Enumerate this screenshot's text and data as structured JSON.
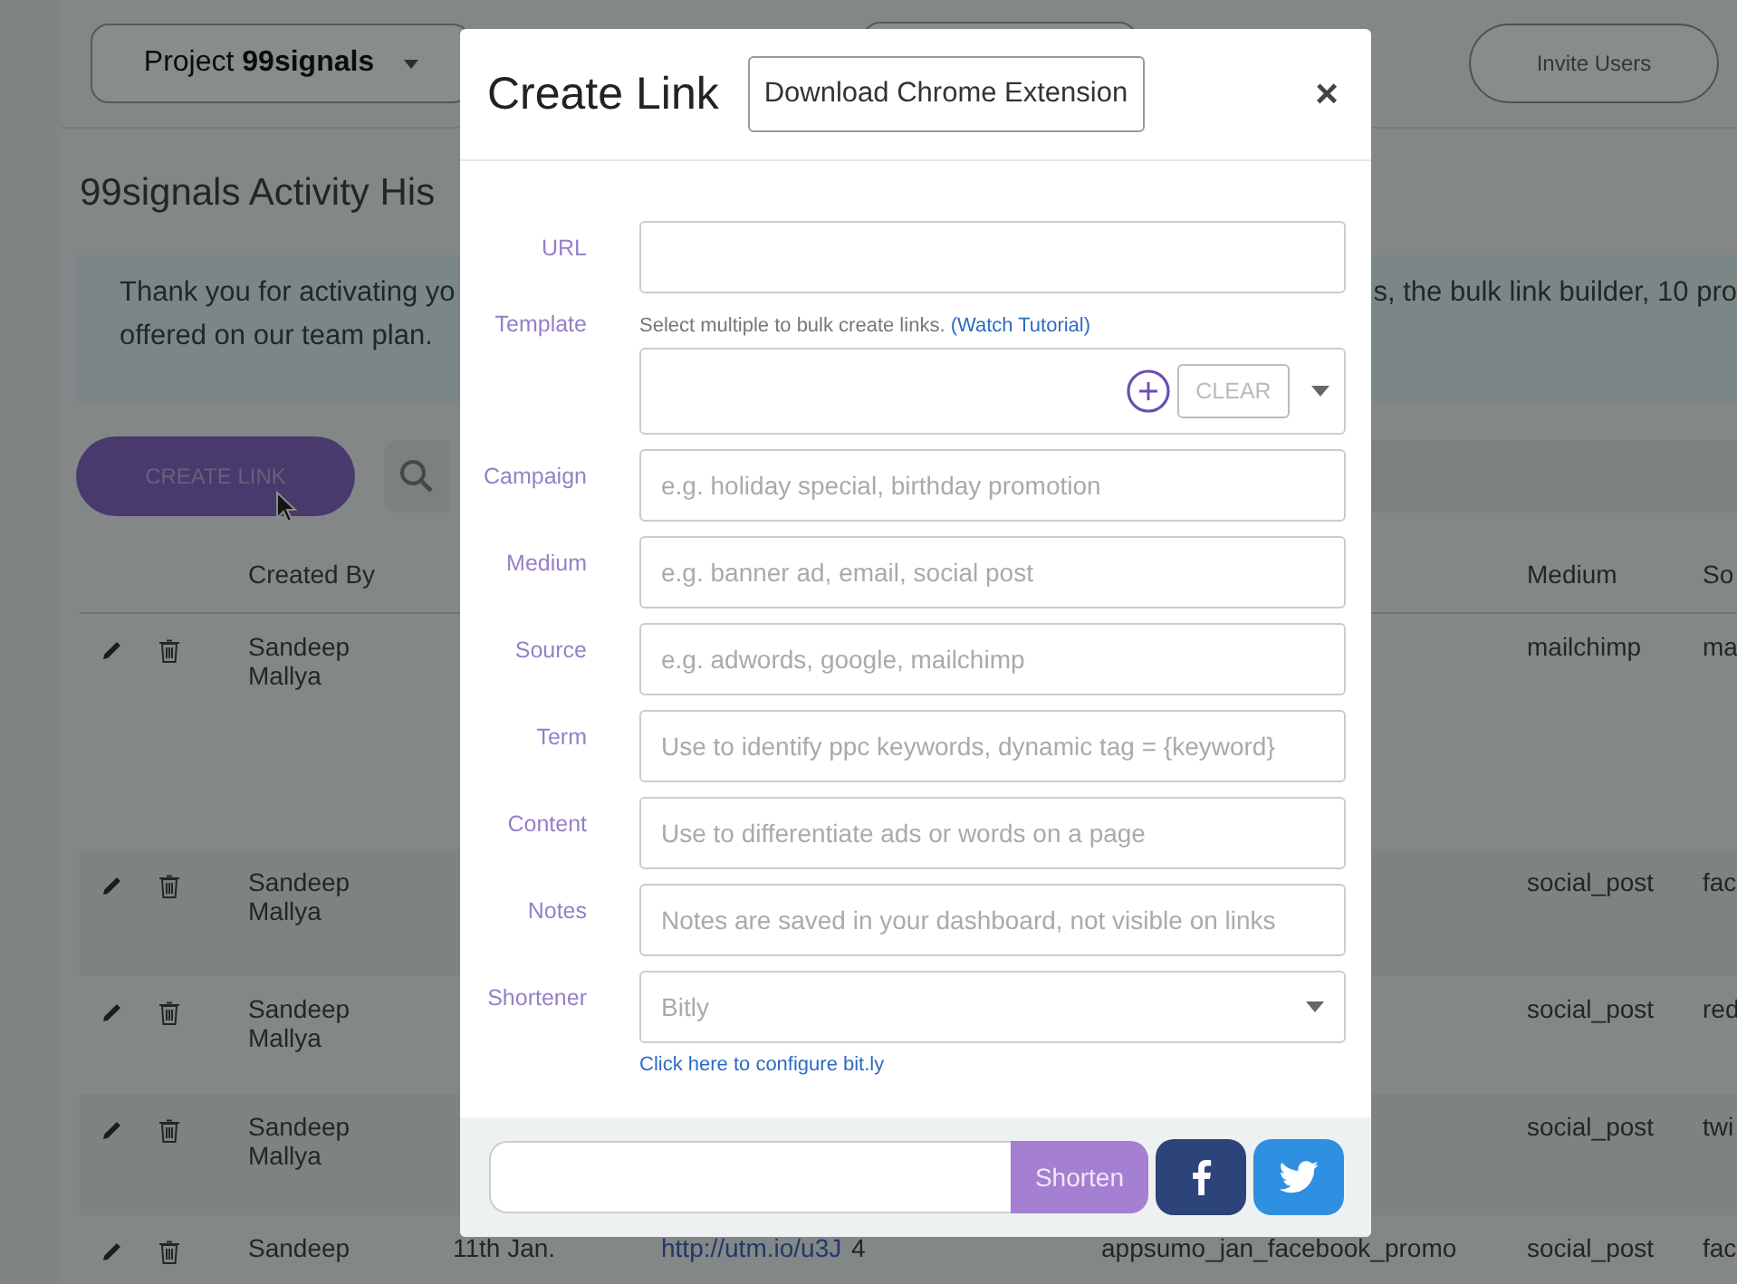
{
  "header": {
    "project_label": "Project",
    "project_name": "99signals",
    "invite_button": "Invite Users"
  },
  "page_title": "99signals Activity His",
  "banner": {
    "left_lines": [
      "Thank you for activating yo",
      "offered on our team plan."
    ],
    "right_lines": [
      "s, the bulk link builder, 10 pro"
    ]
  },
  "create_button": "CREATE LINK",
  "table": {
    "columns": [
      {
        "label": "Created By"
      },
      {
        "label": "Medium"
      },
      {
        "label": "So"
      }
    ],
    "rows": [
      {
        "created_by": "Sandeep Mallya",
        "medium": "mailchimp",
        "source": "ma"
      },
      {
        "created_by": "Sandeep Mallya",
        "medium": "social_post",
        "source": "fac"
      },
      {
        "created_by": "Sandeep Mallya",
        "medium": "social_post",
        "source": "red"
      },
      {
        "created_by": "Sandeep Mallya",
        "medium": "social_post",
        "source": "twi"
      },
      {
        "created_by": "Sandeep",
        "date": "11th Jan.",
        "link": "http://utm.io/u3J",
        "clicks": "4",
        "campaign": "appsumo_jan_facebook_promo",
        "medium": "social_post",
        "source": "fac"
      }
    ]
  },
  "modal": {
    "title": "Create Link",
    "extension_button": "Download Chrome Extension",
    "close": "×",
    "fields": [
      {
        "kind": "text",
        "label": "URL"
      },
      {
        "kind": "template",
        "label": "Template",
        "hint": "Select multiple to bulk create links.",
        "hint_link": "(Watch Tutorial)",
        "clear_button": "CLEAR"
      },
      {
        "kind": "text",
        "label": "Campaign",
        "placeholder": "e.g. holiday special, birthday promotion"
      },
      {
        "kind": "text",
        "label": "Medium",
        "placeholder": "e.g. banner ad, email, social post"
      },
      {
        "kind": "text",
        "label": "Source",
        "placeholder": "e.g. adwords, google, mailchimp"
      },
      {
        "kind": "text",
        "label": "Term",
        "placeholder": "Use to identify ppc keywords, dynamic tag = {keyword}"
      },
      {
        "kind": "text",
        "label": "Content",
        "placeholder": "Use to differentiate ads or words on a page"
      },
      {
        "kind": "text",
        "label": "Notes",
        "placeholder": "Notes are saved in your dashboard, not visible on links"
      },
      {
        "kind": "select",
        "label": "Shortener",
        "value": "Bitly",
        "help_link": "Click here to configure bit.ly"
      }
    ],
    "footer": {
      "shorten_button": "Shorten"
    }
  }
}
